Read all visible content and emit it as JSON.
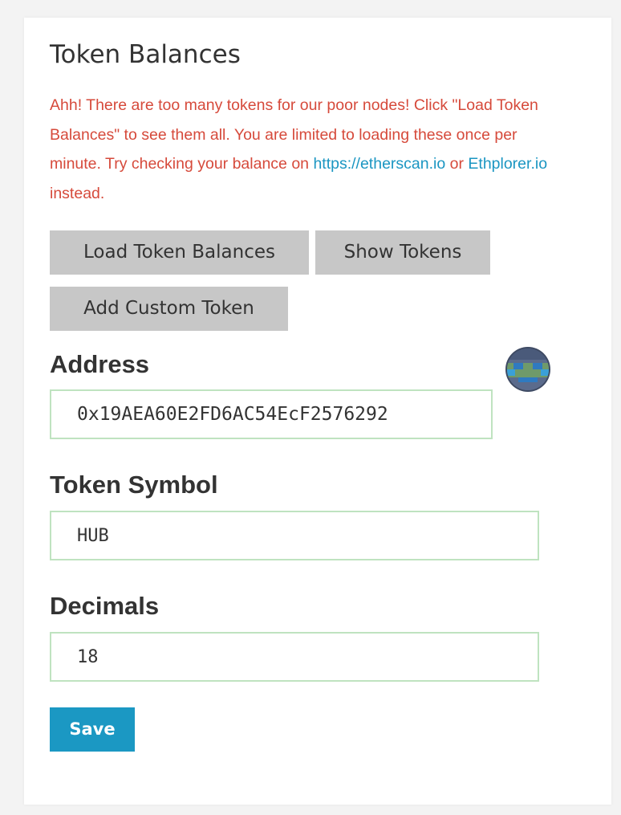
{
  "section": {
    "title": "Token Balances"
  },
  "warning": {
    "text_before": "Ahh! There are too many tokens for our poor nodes! Click \"Load Token Balances\" to see them all. You are limited to loading these once per minute. Try checking your balance on ",
    "link1": "https://etherscan.io",
    "connector": " or ",
    "link2": "Ethplorer.io",
    "text_after": " instead."
  },
  "buttons": {
    "load": "Load Token Balances",
    "show": "Show Tokens",
    "add": "Add Custom Token"
  },
  "form": {
    "address_label": "Address",
    "address_value": "0x19AEA60E2FD6AC54EcF2576292",
    "symbol_label": "Token Symbol",
    "symbol_value": "HUB",
    "decimals_label": "Decimals",
    "decimals_value": "18",
    "save_label": "Save"
  },
  "identicon": {
    "icon": "address-identicon-icon"
  },
  "colors": {
    "warning": "#d64a3b",
    "link": "#1b96c2",
    "button_gray": "#c7c7c7",
    "save_blue": "#1b98c3",
    "field_border": "#bfe3c0"
  }
}
